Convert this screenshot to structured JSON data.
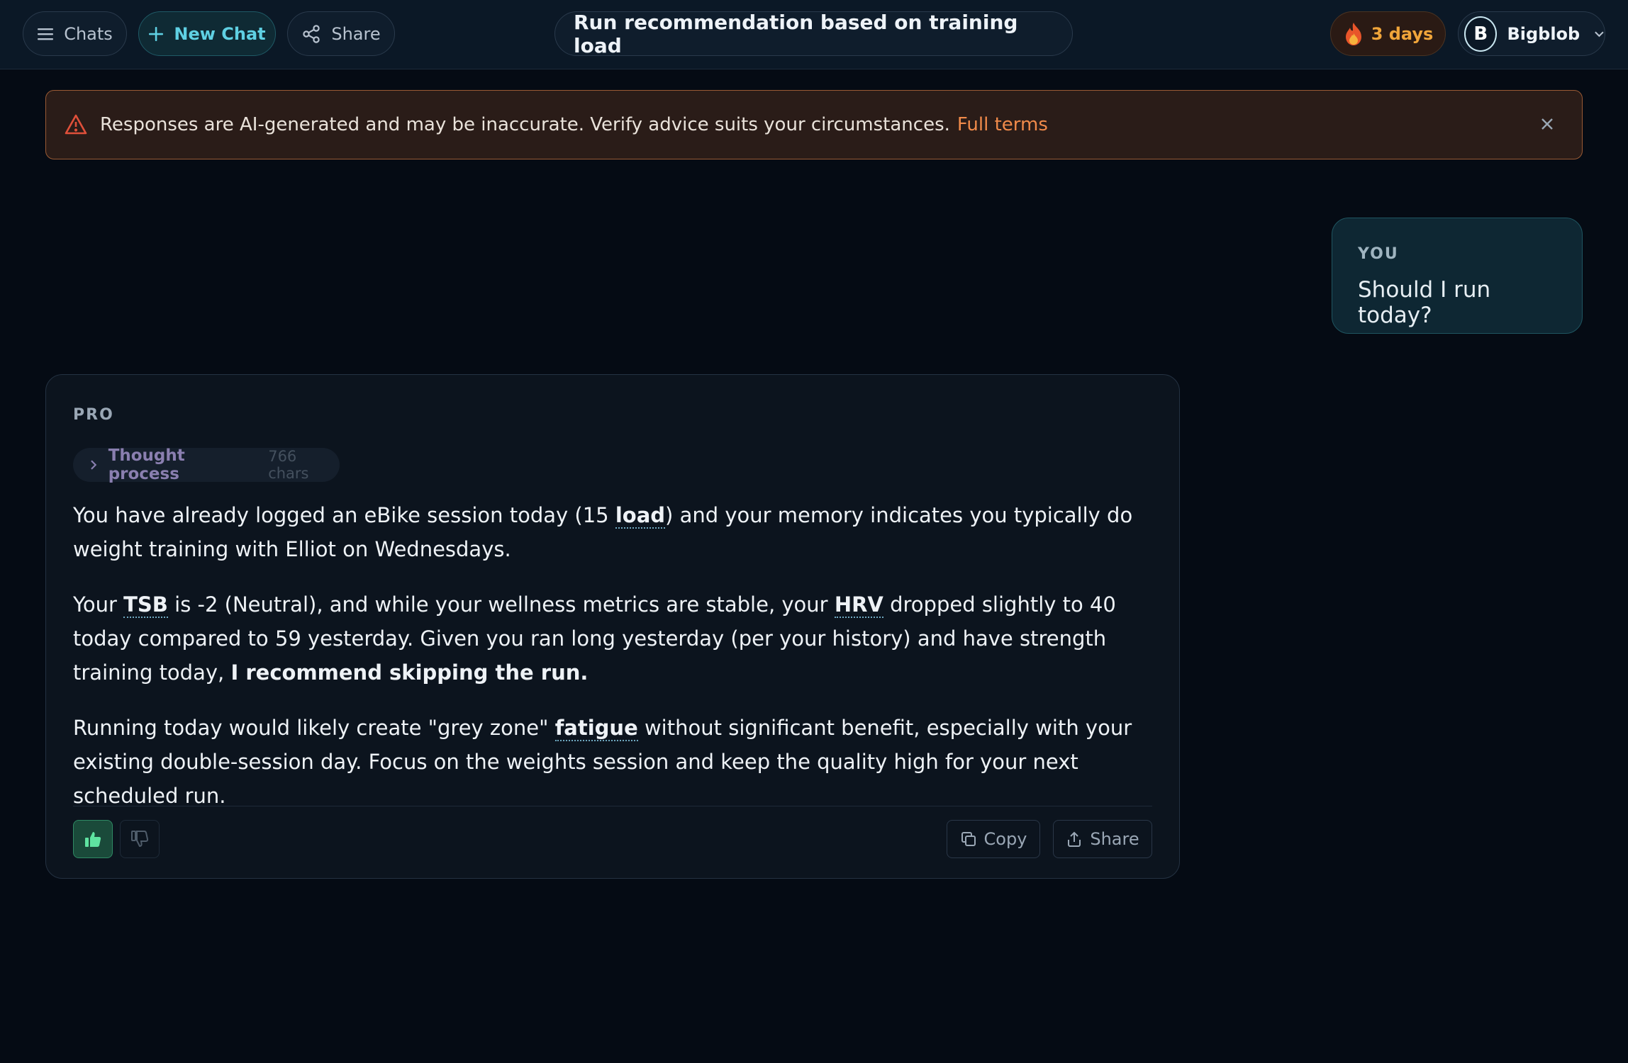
{
  "header": {
    "chats_label": "Chats",
    "new_chat_label": "New Chat",
    "share_label": "Share",
    "conversation_title": "Run recommendation based on training load",
    "streak_label": "3 days",
    "user_initial": "B",
    "user_name": "Bigblob"
  },
  "banner": {
    "message": "Responses are AI-generated and may be inaccurate. Verify advice suits your circumstances.",
    "link_label": "Full terms"
  },
  "user_message": {
    "role_label": "YOU",
    "text": "Should I run today?"
  },
  "assistant_message": {
    "role_label": "PRO",
    "thought_label": "Thought process",
    "thought_count": "766 chars",
    "p1_a": "You have already logged an eBike session today (15 ",
    "p1_term": "load",
    "p1_b": ") and your memory indicates you typically do weight training with Elliot on Wednesdays.",
    "p2_a": "Your ",
    "p2_term1": "TSB",
    "p2_b": " is -2 (Neutral), and while your wellness metrics are stable, your ",
    "p2_term2": "HRV",
    "p2_c": " dropped slightly to 40 today compared to 59 yesterday. Given you ran long yesterday (per your history) and have strength training today, ",
    "p2_bold": "I recommend skipping the run.",
    "p3_a": "Running today would likely create \"grey zone\" ",
    "p3_term": "fatigue",
    "p3_b": " without significant benefit, especially with your existing double-session day. Focus on the weights session and keep the quality high for your next scheduled run.",
    "copy_label": "Copy",
    "share_label": "Share"
  },
  "colors": {
    "accent": "#5fd0e3",
    "streak": "#f0a53a",
    "warning_border": "#9a5a34",
    "link": "#f08a4a",
    "thumb_up": "#2f8a64"
  }
}
